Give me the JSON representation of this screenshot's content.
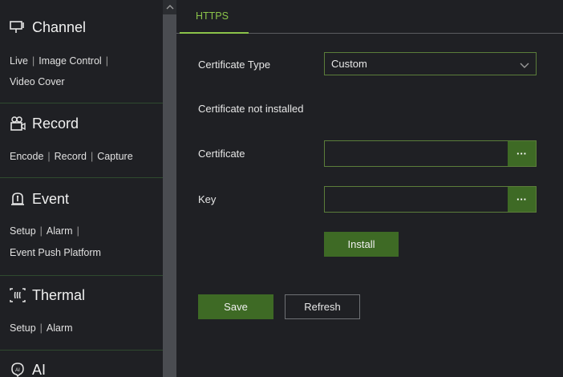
{
  "sidebar": {
    "sections": [
      {
        "title": "Channel",
        "icon": "monitor-icon",
        "links": [
          [
            "Live",
            "Image Control"
          ],
          [
            "Video Cover"
          ]
        ]
      },
      {
        "title": "Record",
        "icon": "camera-recorder-icon",
        "links": [
          [
            "Encode",
            "Record",
            "Capture"
          ]
        ]
      },
      {
        "title": "Event",
        "icon": "alarm-icon",
        "links": [
          [
            "Setup",
            "Alarm"
          ],
          [
            "Event Push Platform"
          ]
        ]
      },
      {
        "title": "Thermal",
        "icon": "thermal-icon",
        "links": [
          [
            "Setup",
            "Alarm"
          ]
        ]
      },
      {
        "title": "AI",
        "icon": "ai-icon",
        "links": []
      }
    ]
  },
  "tabs": {
    "active": "HTTPS"
  },
  "form": {
    "certificate_type_label": "Certificate Type",
    "certificate_type_value": "Custom",
    "status_text": "Certificate not installed",
    "certificate_label": "Certificate",
    "certificate_value": "",
    "key_label": "Key",
    "key_value": "",
    "browse_label": "···",
    "install_label": "Install"
  },
  "actions": {
    "save_label": "Save",
    "refresh_label": "Refresh"
  },
  "colors": {
    "accent": "#8bc34a",
    "button": "#3e6a25",
    "background": "#1f2024"
  }
}
